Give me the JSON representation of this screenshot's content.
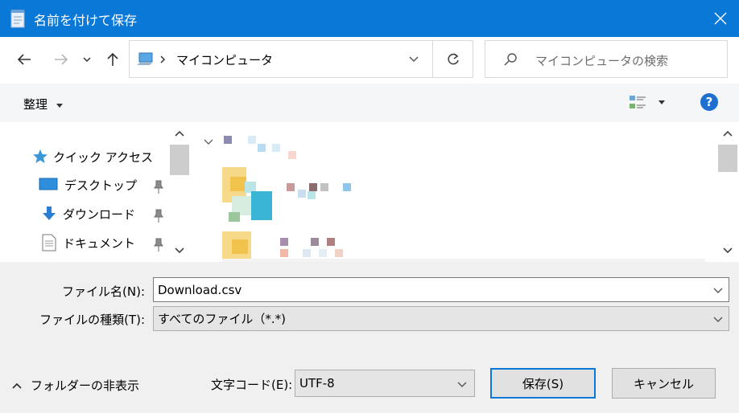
{
  "window": {
    "title": "名前を付けて保存"
  },
  "address": {
    "location": "マイコンピュータ"
  },
  "search": {
    "placeholder": "マイコンピュータの検索"
  },
  "toolbar": {
    "organize_label": "整理"
  },
  "nav_pane": {
    "items": [
      {
        "label": "クイック アクセス",
        "icon": "star-icon",
        "pinned": false
      },
      {
        "label": "デスクトップ",
        "icon": "desktop-icon",
        "pinned": true
      },
      {
        "label": "ダウンロード",
        "icon": "download-arrow-icon",
        "pinned": true
      },
      {
        "label": "ドキュメント",
        "icon": "document-icon",
        "pinned": true
      }
    ]
  },
  "form": {
    "filename_label": "ファイル名(N):",
    "filename_value": "Download.csv",
    "filetype_label": "ファイルの種類(T):",
    "filetype_value": "すべてのファイル（*.*)",
    "encoding_label": "文字コード(E):",
    "encoding_value": "UTF-8",
    "hide_folders_label": "フォルダーの非表示",
    "save_label": "保存(S)",
    "cancel_label": "キャンセル"
  },
  "colors": {
    "titlebar": "#0a78d7",
    "accent": "#0a78d7",
    "help": "#1e6fd0"
  }
}
